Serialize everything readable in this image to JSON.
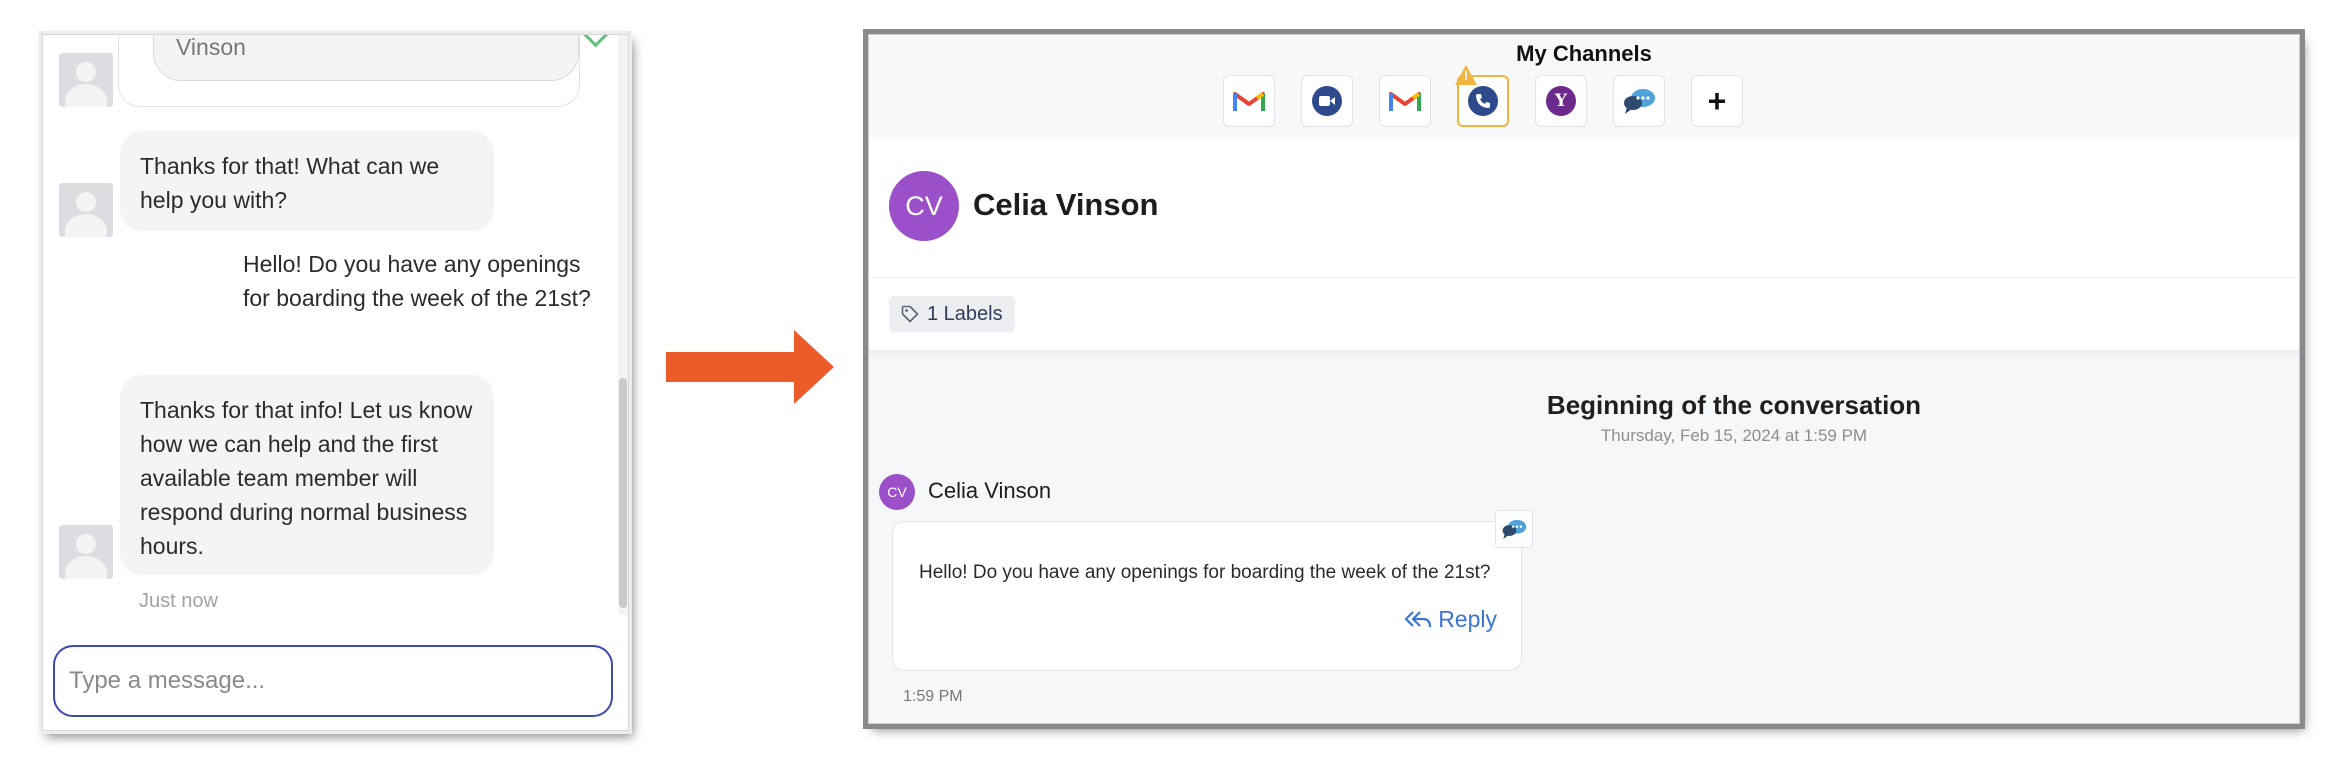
{
  "widget": {
    "form_value": "Vinson",
    "messages": [
      {
        "from": "bot",
        "text": "Thanks for that! What can we help you with?"
      },
      {
        "from": "user",
        "text": "Hello! Do you have any openings for boarding the week of the 21st?"
      },
      {
        "from": "bot",
        "text": "Thanks for that info! Let us know how we can help and the first available team member will respond during normal business hours."
      }
    ],
    "timestamp": "Just now",
    "input_placeholder": "Type a message..."
  },
  "colors": {
    "arrow": "#ec5b2a",
    "avatar_purple": "#9b4fc9",
    "active_channel_border": "#f2b440",
    "reply_blue": "#3b74d6",
    "input_border": "#3b4bb0"
  },
  "crm": {
    "channels_title": "My Channels",
    "channels": [
      {
        "icon": "gmail-icon"
      },
      {
        "icon": "video-call-icon"
      },
      {
        "icon": "gmail-icon"
      },
      {
        "icon": "phone-icon",
        "active": true,
        "warning": true
      },
      {
        "icon": "yahoo-icon",
        "glyph": "Y"
      },
      {
        "icon": "webchat-icon"
      },
      {
        "icon": "add-channel-icon",
        "glyph": "+"
      }
    ],
    "contact": {
      "initials": "CV",
      "name": "Celia Vinson"
    },
    "labels_chip": "1 Labels",
    "conversation": {
      "title": "Beginning of the conversation",
      "date": "Thursday, Feb 15, 2024 at 1:59 PM",
      "sender_initials": "CV",
      "sender_name": "Celia Vinson",
      "message": "Hello! Do you have any openings for boarding the week of the 21st?",
      "reply_label": "Reply",
      "time": "1:59 PM"
    }
  }
}
